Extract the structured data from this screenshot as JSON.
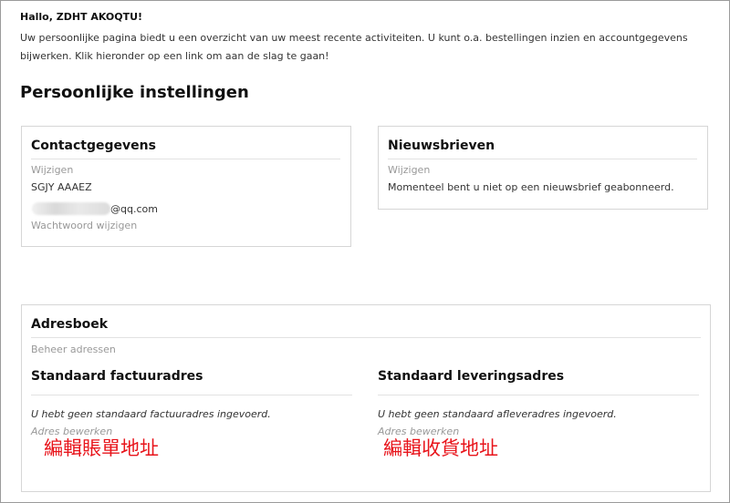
{
  "greeting": "Hallo, ZDHT AKOQTU!",
  "intro": "Uw persoonlijke pagina biedt u een overzicht van uw meest recente activiteiten. U kunt o.a. bestellingen inzien en accountgegevens bijwerken. Klik hieronder op een link om aan de slag te gaan!",
  "section_title": "Persoonlijke instellingen",
  "contact": {
    "title": "Contactgegevens",
    "edit_label": "Wijzigen",
    "name": "SGJY AAAEZ",
    "email_suffix": "@qq.com",
    "password_link": "Wachtwoord wijzigen"
  },
  "newsletter": {
    "title": "Nieuwsbrieven",
    "edit_label": "Wijzigen",
    "status": "Momenteel bent u niet op een nieuwsbrief geabonneerd."
  },
  "addressbook": {
    "title": "Adresboek",
    "manage_label": "Beheer adressen",
    "billing": {
      "title": "Standaard factuuradres",
      "empty": "U hebt geen standaard factuuradres ingevoerd.",
      "edit_link": "Adres bewerken",
      "annotation": "編輯賬單地址"
    },
    "shipping": {
      "title": "Standaard leveringsadres",
      "empty": "U hebt geen standaard afleveradres ingevoerd.",
      "edit_link": "Adres bewerken",
      "annotation": "編輯收貨地址"
    }
  },
  "colors": {
    "annotation_red": "#e8141b",
    "muted_link": "#999999",
    "border": "#d6d6d6"
  }
}
